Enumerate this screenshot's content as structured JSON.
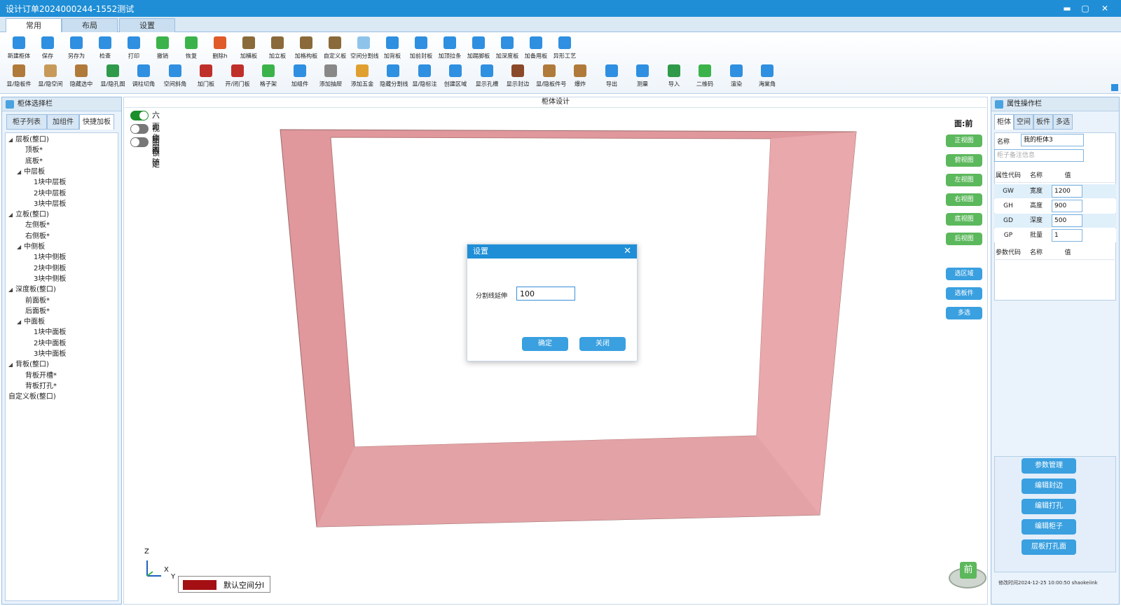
{
  "window": {
    "title": "设计订单2024000244-1552测试",
    "minimize": "▬",
    "maximize": "▢",
    "close": "✕"
  },
  "tabs": [
    "常用",
    "布局",
    "设置"
  ],
  "ribbon": {
    "row1": [
      {
        "label": "新建柜体",
        "color": "#2f8fe0"
      },
      {
        "label": "保存",
        "color": "#2f8fe0"
      },
      {
        "label": "另存为",
        "color": "#2f8fe0"
      },
      {
        "label": "检查",
        "color": "#2f8fe0"
      },
      {
        "label": "打印",
        "color": "#2f8fe0"
      },
      {
        "label": "撤销",
        "color": "#3bb34a"
      },
      {
        "label": "恢复",
        "color": "#3bb34a"
      },
      {
        "label": "删除h",
        "color": "#e05a2a"
      },
      {
        "label": "加横板",
        "color": "#8a6a3a"
      },
      {
        "label": "加立板",
        "color": "#8a6a3a"
      },
      {
        "label": "加格构板",
        "color": "#8a6a3a"
      },
      {
        "label": "自定义板",
        "color": "#8a6a3a"
      },
      {
        "label": "空间分割线",
        "color": "#8fc4ea"
      },
      {
        "label": "加背板",
        "color": "#2f8fe0"
      },
      {
        "label": "加前封板",
        "color": "#2f8fe0"
      },
      {
        "label": "加顶拉条",
        "color": "#2f8fe0"
      },
      {
        "label": "加踢脚板",
        "color": "#2f8fe0"
      },
      {
        "label": "加深度板",
        "color": "#2f8fe0"
      },
      {
        "label": "加备用板",
        "color": "#2f8fe0"
      },
      {
        "label": "异形工艺",
        "color": "#2f8fe0"
      }
    ],
    "row2": [
      {
        "label": "显/隐板件",
        "color": "#b07a3a"
      },
      {
        "label": "显/隐空间",
        "color": "#c79a5a"
      },
      {
        "label": "隐藏选中",
        "color": "#b07a3a"
      },
      {
        "label": "显/隐孔图",
        "color": "#2f9a4a"
      },
      {
        "label": "调柱切角",
        "color": "#2f8fe0"
      },
      {
        "label": "空间斜角",
        "color": "#2f8fe0"
      },
      {
        "label": "加门板",
        "color": "#c0302a"
      },
      {
        "label": "开/闭门板",
        "color": "#c0302a"
      },
      {
        "label": "格子架",
        "color": "#3bb34a"
      },
      {
        "label": "加组件",
        "color": "#2f8fe0"
      },
      {
        "label": "添加抽屉",
        "color": "#888888"
      },
      {
        "label": "添加五金",
        "color": "#e0a030"
      },
      {
        "label": "隐藏分割线",
        "color": "#2f8fe0"
      },
      {
        "label": "显/隐标注",
        "color": "#2f8fe0"
      },
      {
        "label": "创建区域",
        "color": "#2f8fe0"
      },
      {
        "label": "显示孔槽",
        "color": "#2f8fe0"
      },
      {
        "label": "显示封边",
        "color": "#8a4a2a"
      },
      {
        "label": "显/隐板件号",
        "color": "#b07a3a"
      },
      {
        "label": "爆炸",
        "color": "#b07a3a"
      },
      {
        "label": "导出",
        "color": "#2f8fe0"
      },
      {
        "label": "测量",
        "color": "#2f8fe0"
      },
      {
        "label": "导入",
        "color": "#2f9a4a"
      },
      {
        "label": "二维码",
        "color": "#3bb34a"
      },
      {
        "label": "渲染",
        "color": "#2f8fe0"
      },
      {
        "label": "海棠角",
        "color": "#2f8fe0"
      }
    ]
  },
  "left_panel": {
    "title": "柜体选择栏",
    "tabs": [
      "柜子列表",
      "加组件",
      "快捷加板"
    ],
    "tree": [
      {
        "label": "层板(整口)",
        "level": 0,
        "arrow": true
      },
      {
        "label": "顶板*",
        "level": 2,
        "arrow": false
      },
      {
        "label": "底板*",
        "level": 2,
        "arrow": false
      },
      {
        "label": "中层板",
        "level": 1,
        "arrow": true
      },
      {
        "label": "1块中层板",
        "level": 3,
        "arrow": false
      },
      {
        "label": "2块中层板",
        "level": 3,
        "arrow": false
      },
      {
        "label": "3块中层板",
        "level": 3,
        "arrow": false
      },
      {
        "label": "立板(整口)",
        "level": 0,
        "arrow": true
      },
      {
        "label": "左侧板*",
        "level": 2,
        "arrow": false
      },
      {
        "label": "右侧板*",
        "level": 2,
        "arrow": false
      },
      {
        "label": "中侧板",
        "level": 1,
        "arrow": true
      },
      {
        "label": "1块中侧板",
        "level": 3,
        "arrow": false
      },
      {
        "label": "2块中侧板",
        "level": 3,
        "arrow": false
      },
      {
        "label": "3块中侧板",
        "level": 3,
        "arrow": false
      },
      {
        "label": "深度板(整口)",
        "level": 0,
        "arrow": true
      },
      {
        "label": "前面板*",
        "level": 2,
        "arrow": false
      },
      {
        "label": "后面板*",
        "level": 2,
        "arrow": false
      },
      {
        "label": "中面板",
        "level": 1,
        "arrow": true
      },
      {
        "label": "1块中面板",
        "level": 3,
        "arrow": false
      },
      {
        "label": "2块中面板",
        "level": 3,
        "arrow": false
      },
      {
        "label": "3块中面板",
        "level": 3,
        "arrow": false
      },
      {
        "label": "背板(整口)",
        "level": 0,
        "arrow": true
      },
      {
        "label": "背板开槽*",
        "level": 2,
        "arrow": false
      },
      {
        "label": "背板打孔*",
        "level": 2,
        "arrow": false
      },
      {
        "label": "自定义板(整口)",
        "level": 0,
        "arrow": false
      }
    ]
  },
  "canvas": {
    "title": "柜体设计",
    "toggles": [
      {
        "label": "六面作图",
        "on": true
      },
      {
        "label": "视图跟随",
        "on": false
      },
      {
        "label": "面锁定",
        "on": false
      }
    ],
    "view_label": "面:前",
    "view_buttons": [
      "正视图",
      "俯视图",
      "左视图",
      "右视图",
      "底视图",
      "后视图"
    ],
    "select_buttons": [
      "选区域",
      "选板件",
      "多选"
    ],
    "axis": {
      "z": "Z",
      "x": "X",
      "y": "Y"
    },
    "legend": {
      "label": "默认空间分l",
      "color": "#a40f14"
    },
    "cube_label": "前",
    "cabinet_color": "#e4a0a4"
  },
  "dialog": {
    "title": "设置",
    "close": "✕",
    "field_label": "分割线延伸",
    "field_value": "100",
    "ok": "确定",
    "cancel": "关闭"
  },
  "right_panel": {
    "title": "属性操作栏",
    "tabs": [
      "柜体",
      "空间",
      "板件",
      "多选"
    ],
    "name_label": "名称",
    "name_value": "我的柜体3",
    "remark_placeholder": "柜子备注信息",
    "attr_headers": [
      "属性代码",
      "名称",
      "值"
    ],
    "attrs": [
      {
        "code": "GW",
        "name": "宽度",
        "value": "1200"
      },
      {
        "code": "GH",
        "name": "高度",
        "value": "900"
      },
      {
        "code": "GD",
        "name": "深度",
        "value": "500"
      },
      {
        "code": "GP",
        "name": "批量",
        "value": "1"
      }
    ],
    "param_headers": [
      "参数代码",
      "名称",
      "值"
    ],
    "buttons": [
      "参数管理",
      "编辑封边",
      "编辑打孔",
      "编辑柜子",
      "层板打孔面"
    ],
    "footer": "修改时间2024-12-25 10:00:50 shaokeiink"
  }
}
